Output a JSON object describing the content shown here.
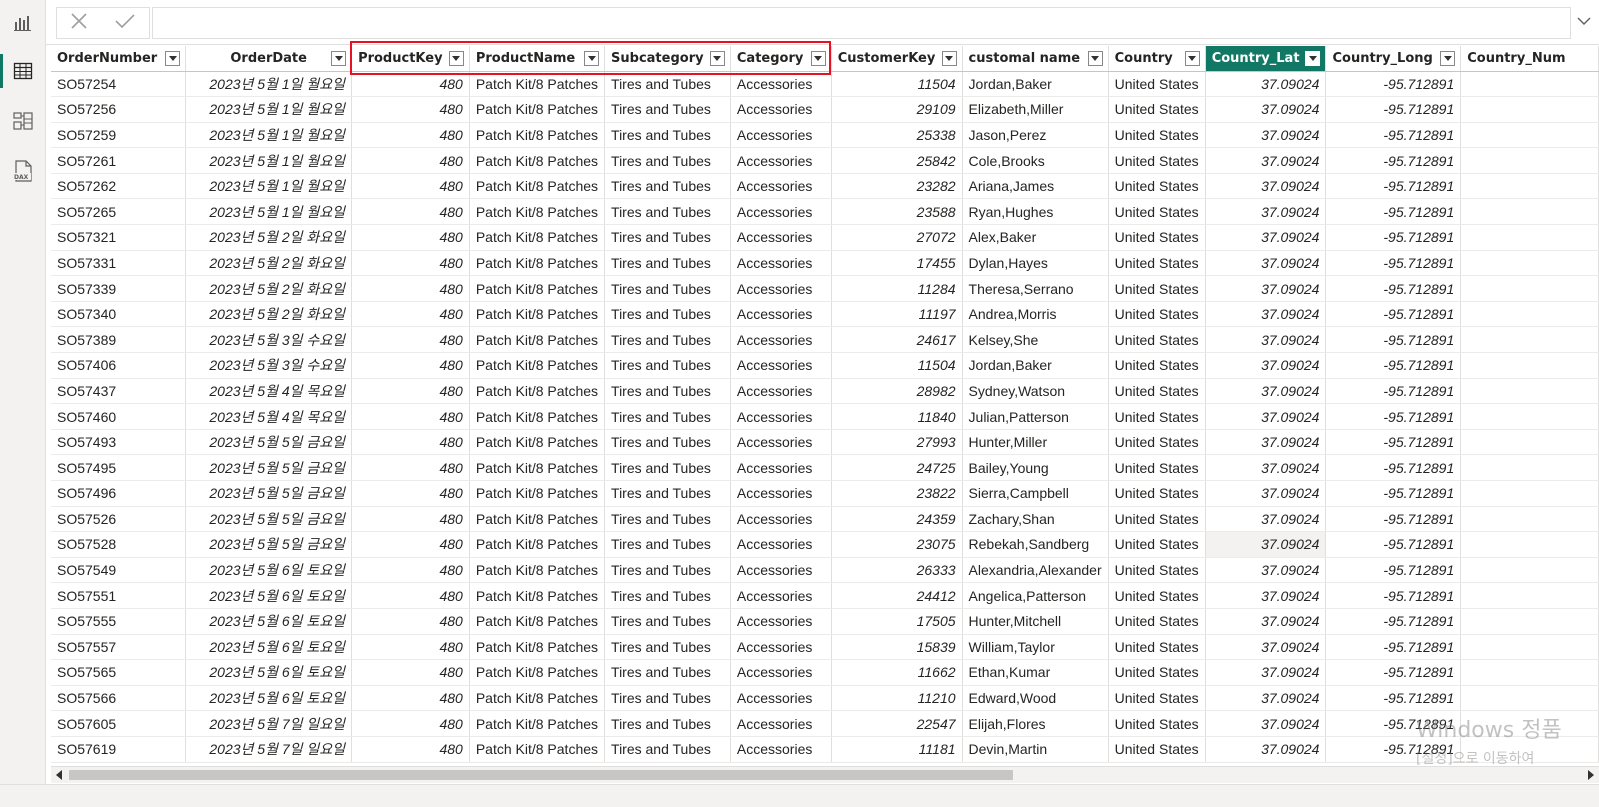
{
  "nav": {
    "items": [
      {
        "name": "report-view-icon"
      },
      {
        "name": "table-view-icon",
        "active": true
      },
      {
        "name": "model-view-icon"
      },
      {
        "name": "dax-query-view-icon"
      }
    ]
  },
  "formula_bar": {
    "value": ""
  },
  "table": {
    "columns": [
      {
        "label": "OrderNumber",
        "w": 0,
        "type": "text"
      },
      {
        "label": "OrderDate",
        "type": "date"
      },
      {
        "label": "ProductKey",
        "type": "num"
      },
      {
        "label": "ProductName",
        "type": "text"
      },
      {
        "label": "Subcategory",
        "type": "text"
      },
      {
        "label": "Category",
        "type": "text"
      },
      {
        "label": "CustomerKey",
        "type": "num"
      },
      {
        "label": "customal name",
        "type": "text"
      },
      {
        "label": "Country",
        "type": "text"
      },
      {
        "label": "Country_Lat",
        "type": "num",
        "selected": true
      },
      {
        "label": "Country_Long",
        "type": "num"
      },
      {
        "label": "Country_Num",
        "type": "text"
      }
    ],
    "rows": [
      [
        "SO57254",
        "2023년 5월 1일 월요일",
        "480",
        "Patch Kit/8 Patches",
        "Tires and Tubes",
        "Accessories",
        "11504",
        "Jordan,Baker",
        "United States",
        "37.09024",
        "-95.712891",
        ""
      ],
      [
        "SO57256",
        "2023년 5월 1일 월요일",
        "480",
        "Patch Kit/8 Patches",
        "Tires and Tubes",
        "Accessories",
        "29109",
        "Elizabeth,Miller",
        "United States",
        "37.09024",
        "-95.712891",
        ""
      ],
      [
        "SO57259",
        "2023년 5월 1일 월요일",
        "480",
        "Patch Kit/8 Patches",
        "Tires and Tubes",
        "Accessories",
        "25338",
        "Jason,Perez",
        "United States",
        "37.09024",
        "-95.712891",
        ""
      ],
      [
        "SO57261",
        "2023년 5월 1일 월요일",
        "480",
        "Patch Kit/8 Patches",
        "Tires and Tubes",
        "Accessories",
        "25842",
        "Cole,Brooks",
        "United States",
        "37.09024",
        "-95.712891",
        ""
      ],
      [
        "SO57262",
        "2023년 5월 1일 월요일",
        "480",
        "Patch Kit/8 Patches",
        "Tires and Tubes",
        "Accessories",
        "23282",
        "Ariana,James",
        "United States",
        "37.09024",
        "-95.712891",
        ""
      ],
      [
        "SO57265",
        "2023년 5월 1일 월요일",
        "480",
        "Patch Kit/8 Patches",
        "Tires and Tubes",
        "Accessories",
        "23588",
        "Ryan,Hughes",
        "United States",
        "37.09024",
        "-95.712891",
        ""
      ],
      [
        "SO57321",
        "2023년 5월 2일 화요일",
        "480",
        "Patch Kit/8 Patches",
        "Tires and Tubes",
        "Accessories",
        "27072",
        "Alex,Baker",
        "United States",
        "37.09024",
        "-95.712891",
        ""
      ],
      [
        "SO57331",
        "2023년 5월 2일 화요일",
        "480",
        "Patch Kit/8 Patches",
        "Tires and Tubes",
        "Accessories",
        "17455",
        "Dylan,Hayes",
        "United States",
        "37.09024",
        "-95.712891",
        ""
      ],
      [
        "SO57339",
        "2023년 5월 2일 화요일",
        "480",
        "Patch Kit/8 Patches",
        "Tires and Tubes",
        "Accessories",
        "11284",
        "Theresa,Serrano",
        "United States",
        "37.09024",
        "-95.712891",
        ""
      ],
      [
        "SO57340",
        "2023년 5월 2일 화요일",
        "480",
        "Patch Kit/8 Patches",
        "Tires and Tubes",
        "Accessories",
        "11197",
        "Andrea,Morris",
        "United States",
        "37.09024",
        "-95.712891",
        ""
      ],
      [
        "SO57389",
        "2023년 5월 3일 수요일",
        "480",
        "Patch Kit/8 Patches",
        "Tires and Tubes",
        "Accessories",
        "24617",
        "Kelsey,She",
        "United States",
        "37.09024",
        "-95.712891",
        ""
      ],
      [
        "SO57406",
        "2023년 5월 3일 수요일",
        "480",
        "Patch Kit/8 Patches",
        "Tires and Tubes",
        "Accessories",
        "11504",
        "Jordan,Baker",
        "United States",
        "37.09024",
        "-95.712891",
        ""
      ],
      [
        "SO57437",
        "2023년 5월 4일 목요일",
        "480",
        "Patch Kit/8 Patches",
        "Tires and Tubes",
        "Accessories",
        "28982",
        "Sydney,Watson",
        "United States",
        "37.09024",
        "-95.712891",
        ""
      ],
      [
        "SO57460",
        "2023년 5월 4일 목요일",
        "480",
        "Patch Kit/8 Patches",
        "Tires and Tubes",
        "Accessories",
        "11840",
        "Julian,Patterson",
        "United States",
        "37.09024",
        "-95.712891",
        ""
      ],
      [
        "SO57493",
        "2023년 5월 5일 금요일",
        "480",
        "Patch Kit/8 Patches",
        "Tires and Tubes",
        "Accessories",
        "27993",
        "Hunter,Miller",
        "United States",
        "37.09024",
        "-95.712891",
        ""
      ],
      [
        "SO57495",
        "2023년 5월 5일 금요일",
        "480",
        "Patch Kit/8 Patches",
        "Tires and Tubes",
        "Accessories",
        "24725",
        "Bailey,Young",
        "United States",
        "37.09024",
        "-95.712891",
        ""
      ],
      [
        "SO57496",
        "2023년 5월 5일 금요일",
        "480",
        "Patch Kit/8 Patches",
        "Tires and Tubes",
        "Accessories",
        "23822",
        "Sierra,Campbell",
        "United States",
        "37.09024",
        "-95.712891",
        ""
      ],
      [
        "SO57526",
        "2023년 5월 5일 금요일",
        "480",
        "Patch Kit/8 Patches",
        "Tires and Tubes",
        "Accessories",
        "24359",
        "Zachary,Shan",
        "United States",
        "37.09024",
        "-95.712891",
        ""
      ],
      [
        "SO57528",
        "2023년 5월 5일 금요일",
        "480",
        "Patch Kit/8 Patches",
        "Tires and Tubes",
        "Accessories",
        "23075",
        "Rebekah,Sandberg",
        "United States",
        "37.09024",
        "-95.712891",
        ""
      ],
      [
        "SO57549",
        "2023년 5월 6일 토요일",
        "480",
        "Patch Kit/8 Patches",
        "Tires and Tubes",
        "Accessories",
        "26333",
        "Alexandria,Alexander",
        "United States",
        "37.09024",
        "-95.712891",
        ""
      ],
      [
        "SO57551",
        "2023년 5월 6일 토요일",
        "480",
        "Patch Kit/8 Patches",
        "Tires and Tubes",
        "Accessories",
        "24412",
        "Angelica,Patterson",
        "United States",
        "37.09024",
        "-95.712891",
        ""
      ],
      [
        "SO57555",
        "2023년 5월 6일 토요일",
        "480",
        "Patch Kit/8 Patches",
        "Tires and Tubes",
        "Accessories",
        "17505",
        "Hunter,Mitchell",
        "United States",
        "37.09024",
        "-95.712891",
        ""
      ],
      [
        "SO57557",
        "2023년 5월 6일 토요일",
        "480",
        "Patch Kit/8 Patches",
        "Tires and Tubes",
        "Accessories",
        "15839",
        "William,Taylor",
        "United States",
        "37.09024",
        "-95.712891",
        ""
      ],
      [
        "SO57565",
        "2023년 5월 6일 토요일",
        "480",
        "Patch Kit/8 Patches",
        "Tires and Tubes",
        "Accessories",
        "11662",
        "Ethan,Kumar",
        "United States",
        "37.09024",
        "-95.712891",
        ""
      ],
      [
        "SO57566",
        "2023년 5월 6일 토요일",
        "480",
        "Patch Kit/8 Patches",
        "Tires and Tubes",
        "Accessories",
        "11210",
        "Edward,Wood",
        "United States",
        "37.09024",
        "-95.712891",
        ""
      ],
      [
        "SO57605",
        "2023년 5월 7일 일요일",
        "480",
        "Patch Kit/8 Patches",
        "Tires and Tubes",
        "Accessories",
        "22547",
        "Elijah,Flores",
        "United States",
        "37.09024",
        "-95.712891",
        ""
      ],
      [
        "SO57619",
        "2023년 5월 7일 일요일",
        "480",
        "Patch Kit/8 Patches",
        "Tires and Tubes",
        "Accessories",
        "11181",
        "Devin,Martin",
        "United States",
        "37.09024",
        "-95.712891",
        ""
      ]
    ],
    "highlighted_cell": {
      "row": 18,
      "col": 9
    }
  },
  "watermark": {
    "line1": "Windows 정품",
    "line2": "[설정]으로 이동하여"
  },
  "colors": {
    "accent": "#117865",
    "highlight_box": "#e81123"
  }
}
